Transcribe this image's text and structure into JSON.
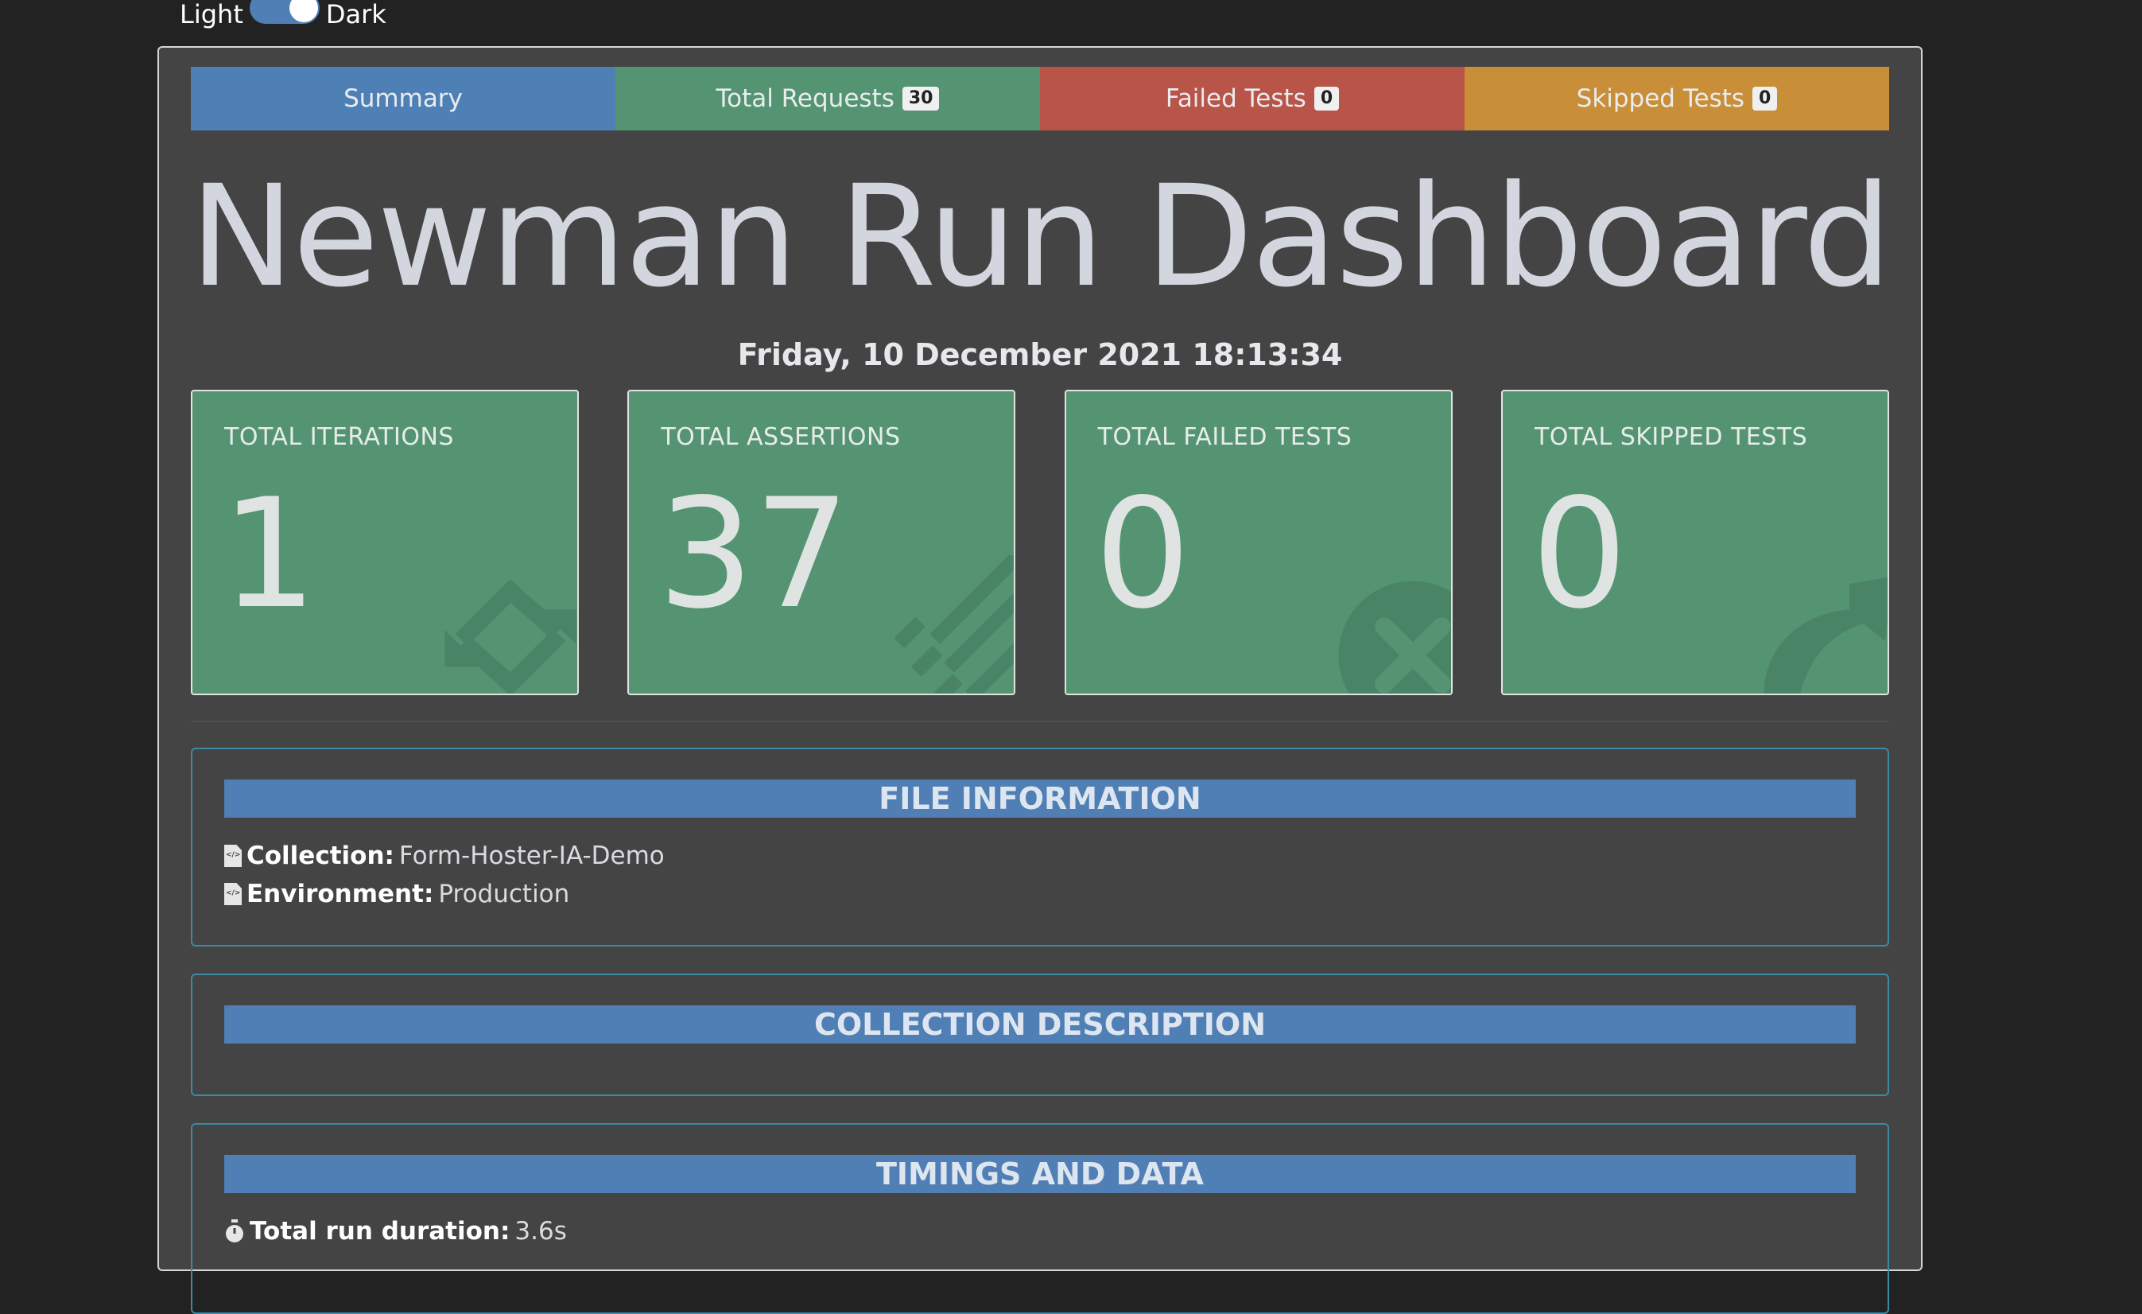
{
  "theme_switch": {
    "light_label": "Light",
    "dark_label": "Dark",
    "state": "dark"
  },
  "tabs": [
    {
      "label": "Summary",
      "badge": null,
      "color": "#4f80b5"
    },
    {
      "label": "Total Requests",
      "badge": "30",
      "color": "#559473"
    },
    {
      "label": "Failed Tests",
      "badge": "0",
      "color": "#b85448"
    },
    {
      "label": "Skipped Tests",
      "badge": "0",
      "color": "#c98f38"
    }
  ],
  "header": {
    "title": "Newman Run Dashboard",
    "timestamp": "Friday, 10 December 2021 18:13:34"
  },
  "cards": [
    {
      "label": "TOTAL ITERATIONS",
      "value": "1",
      "icon": "sync-icon"
    },
    {
      "label": "TOTAL ASSERTIONS",
      "value": "37",
      "icon": "tasks-icon"
    },
    {
      "label": "TOTAL FAILED TESTS",
      "value": "0",
      "icon": "times-circle-icon"
    },
    {
      "label": "TOTAL SKIPPED TESTS",
      "value": "0",
      "icon": "share-icon"
    }
  ],
  "file_info": {
    "heading": "FILE INFORMATION",
    "collection_label": "Collection:",
    "collection_value": "Form-Hoster-IA-Demo",
    "environment_label": "Environment:",
    "environment_value": "Production"
  },
  "collection_description": {
    "heading": "COLLECTION DESCRIPTION"
  },
  "timings": {
    "heading": "TIMINGS AND DATA",
    "duration_label": "Total run duration:",
    "duration_value": "3.6s"
  }
}
